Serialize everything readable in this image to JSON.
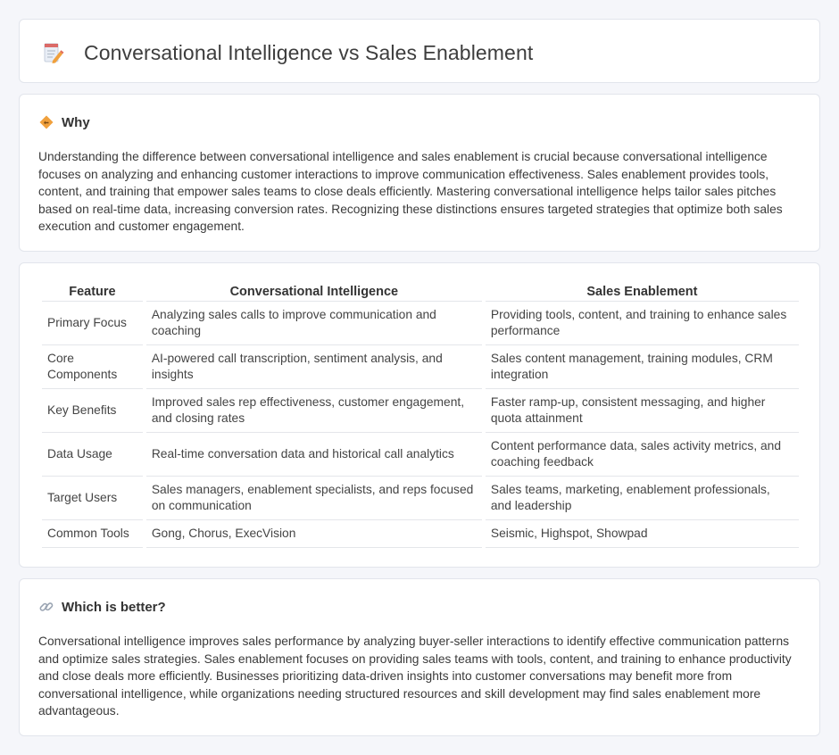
{
  "header": {
    "title": "Conversational Intelligence vs Sales Enablement",
    "icon": "document-edit-icon"
  },
  "why": {
    "heading": "Why",
    "icon": "diamond-sign-icon",
    "body": "Understanding the difference between conversational intelligence and sales enablement is crucial because conversational intelligence focuses on analyzing and enhancing customer interactions to improve communication effectiveness. Sales enablement provides tools, content, and training that empower sales teams to close deals efficiently. Mastering conversational intelligence helps tailor sales pitches based on real-time data, increasing conversion rates. Recognizing these distinctions ensures targeted strategies that optimize both sales execution and customer engagement."
  },
  "comparison": {
    "headers": [
      "Feature",
      "Conversational Intelligence",
      "Sales Enablement"
    ],
    "rows": [
      [
        "Primary Focus",
        "Analyzing sales calls to improve communication and coaching",
        "Providing tools, content, and training to enhance sales performance"
      ],
      [
        "Core Components",
        "AI-powered call transcription, sentiment analysis, and insights",
        "Sales content management, training modules, CRM integration"
      ],
      [
        "Key Benefits",
        "Improved sales rep effectiveness, customer engagement, and closing rates",
        "Faster ramp-up, consistent messaging, and higher quota attainment"
      ],
      [
        "Data Usage",
        "Real-time conversation data and historical call analytics",
        "Content performance data, sales activity metrics, and coaching feedback"
      ],
      [
        "Target Users",
        "Sales managers, enablement specialists, and reps focused on communication",
        "Sales teams, marketing, enablement professionals, and leadership"
      ],
      [
        "Common Tools",
        "Gong, Chorus, ExecVision",
        "Seismic, Highspot, Showpad"
      ]
    ]
  },
  "better": {
    "heading": "Which is better?",
    "icon": "link-icon",
    "body": "Conversational intelligence improves sales performance by analyzing buyer-seller interactions to identify effective communication patterns and optimize sales strategies. Sales enablement focuses on providing sales teams with tools, content, and training to enhance productivity and close deals more efficiently. Businesses prioritizing data-driven insights into customer conversations may benefit more from conversational intelligence, while organizations needing structured resources and skill development may find sales enablement more advantageous."
  },
  "colors": {
    "background": "#f5f6fa",
    "card": "#ffffff",
    "border": "#e2e5ec",
    "accent_orange": "#f0a03c"
  }
}
